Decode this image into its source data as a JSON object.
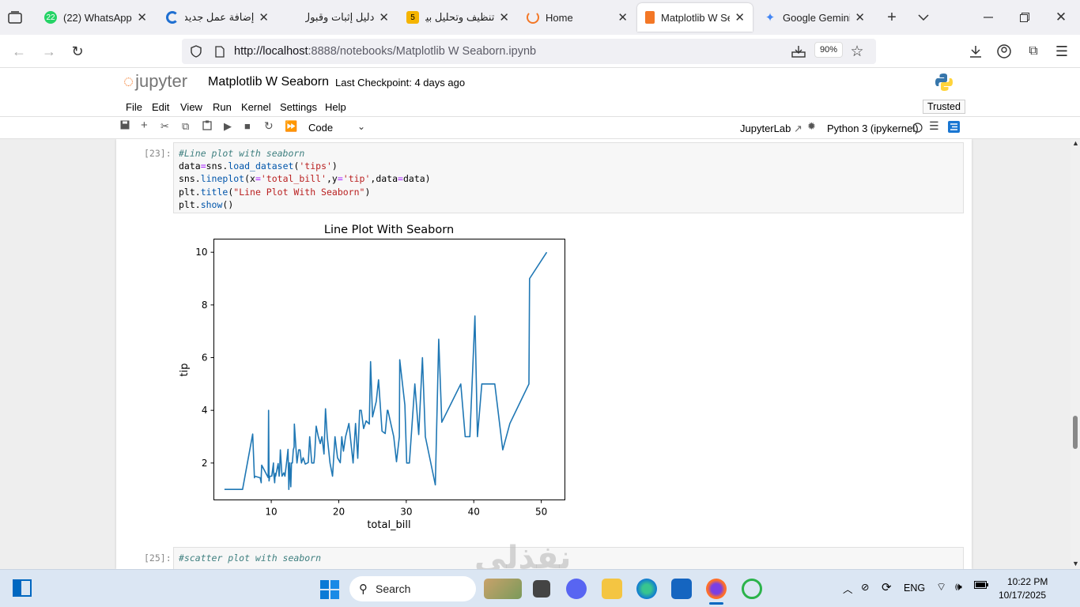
{
  "browser": {
    "tabs": [
      {
        "title": "(22) WhatsApp",
        "badge": "22",
        "icon": "whatsapp-icon",
        "active": false
      },
      {
        "title": "إضافة عمل جديد |",
        "icon": "swirl-icon",
        "active": false
      },
      {
        "title": "دليل إثبات وقبول المهـ",
        "icon": "blank-icon",
        "active": false
      },
      {
        "title": "تنظيف وتحليل بيانـ",
        "badge": "5",
        "icon": "yellow-badge-icon",
        "active": false
      },
      {
        "title": "Home",
        "icon": "spinner-icon",
        "active": false
      },
      {
        "title": "Matplotlib W Seal",
        "icon": "notebook-icon",
        "active": true
      },
      {
        "title": "Google Gemini",
        "icon": "gemini-icon",
        "active": false
      }
    ],
    "url_host": "http://localhost",
    "url_rest": ":8888/notebooks/Matplotlib W Seaborn.ipynb",
    "zoom": "90%"
  },
  "jupyter": {
    "logo_text": "jupyter",
    "notebook_title": "Matplotlib W Seaborn",
    "checkpoint": "Last Checkpoint: 4 days ago",
    "menu": [
      "File",
      "Edit",
      "View",
      "Run",
      "Kernel",
      "Settings",
      "Help"
    ],
    "trusted": "Trusted",
    "cell_type": "Code",
    "jupyterlab_link": "JupyterLab",
    "kernel": "Python 3 (ipykernel)"
  },
  "cells": [
    {
      "prompt": "[23]:",
      "lines": [
        "#Line plot with seaborn",
        "data=sns.load_dataset('tips')",
        "sns.lineplot(x='total_bill',y='tip',data=data)",
        "plt.title(\"Line Plot With Seaborn\")",
        "plt.show()"
      ]
    },
    {
      "prompt": "[25]:",
      "lines": [
        "#scatter plot with seaborn"
      ]
    }
  ],
  "chart_data": {
    "type": "line",
    "title": "Line Plot With Seaborn",
    "xlabel": "total_bill",
    "ylabel": "tip",
    "xlim": [
      1.5,
      53.5
    ],
    "ylim": [
      0.6,
      10.5
    ],
    "xticks": [
      10,
      20,
      30,
      40,
      50
    ],
    "yticks": [
      2,
      4,
      6,
      8,
      10
    ],
    "color": "#1f77b4",
    "grid": false,
    "series": [
      {
        "x": [
          3.07,
          5.75,
          7.25,
          7.51,
          7.56,
          8.35,
          8.51,
          8.52,
          8.58,
          9.55,
          9.6,
          9.68,
          9.78,
          10.07,
          10.33,
          10.34,
          10.51,
          10.59,
          10.65,
          11.02,
          11.17,
          11.24,
          11.35,
          11.59,
          11.87,
          12.03,
          12.26,
          12.48,
          12.6,
          12.74,
          12.9,
          13.0,
          13.03,
          13.13,
          13.27,
          13.39,
          13.42,
          13.81,
          14.07,
          14.26,
          14.48,
          14.73,
          15.04,
          15.36,
          15.48,
          15.69,
          16.0,
          16.31,
          16.43,
          16.66,
          16.97,
          17.26,
          17.51,
          17.81,
          18.04,
          18.29,
          18.71,
          19.08,
          19.44,
          19.82,
          20.23,
          20.45,
          20.69,
          21.01,
          21.5,
          22.12,
          22.49,
          22.82,
          23.1,
          23.33,
          23.68,
          24.06,
          24.52,
          24.71,
          25.0,
          25.56,
          25.89,
          26.41,
          26.88,
          27.2,
          27.28,
          28.15,
          28.55,
          28.97,
          29.03,
          29.8,
          30.06,
          30.46,
          31.27,
          31.85,
          32.4,
          32.83,
          34.3,
          34.81,
          35.26,
          38.07,
          38.73,
          39.42,
          40.17,
          40.55,
          41.19,
          43.11,
          44.3,
          45.35,
          48.17,
          48.27,
          50.81
        ],
        "y": [
          1.0,
          1.0,
          3.1,
          1.44,
          1.5,
          1.44,
          1.25,
          1.48,
          1.92,
          1.45,
          4.0,
          1.32,
          1.5,
          1.5,
          2.0,
          1.66,
          1.25,
          1.61,
          1.5,
          1.98,
          1.5,
          1.76,
          2.5,
          1.5,
          1.63,
          1.5,
          2.0,
          2.52,
          1.0,
          2.01,
          1.1,
          2.0,
          2.0,
          2.0,
          2.5,
          2.61,
          3.48,
          2.0,
          2.5,
          2.5,
          2.0,
          2.2,
          1.96,
          2.0,
          2.02,
          3.0,
          2.0,
          2.0,
          2.3,
          3.4,
          3.0,
          2.74,
          3.0,
          2.34,
          4.06,
          3.0,
          2.0,
          1.5,
          3.0,
          2.2,
          2.01,
          3.0,
          2.45,
          3.0,
          3.5,
          2.0,
          3.5,
          2.18,
          4.0,
          4.0,
          3.31,
          3.6,
          3.48,
          5.85,
          3.75,
          4.34,
          5.16,
          3.21,
          3.12,
          4.0,
          4.0,
          3.0,
          2.05,
          3.0,
          5.92,
          4.2,
          2.0,
          2.0,
          5.0,
          3.08,
          6.0,
          3.0,
          1.17,
          6.7,
          3.55,
          5.0,
          3.0,
          3.0,
          7.58,
          3.0,
          5.0,
          5.0,
          2.5,
          3.5,
          5.0,
          9.0,
          10.0
        ]
      }
    ]
  },
  "taskbar": {
    "search_placeholder": "Search",
    "language": "ENG",
    "time": "10:22 PM",
    "date": "10/17/2025"
  },
  "watermark": "نفذلي"
}
